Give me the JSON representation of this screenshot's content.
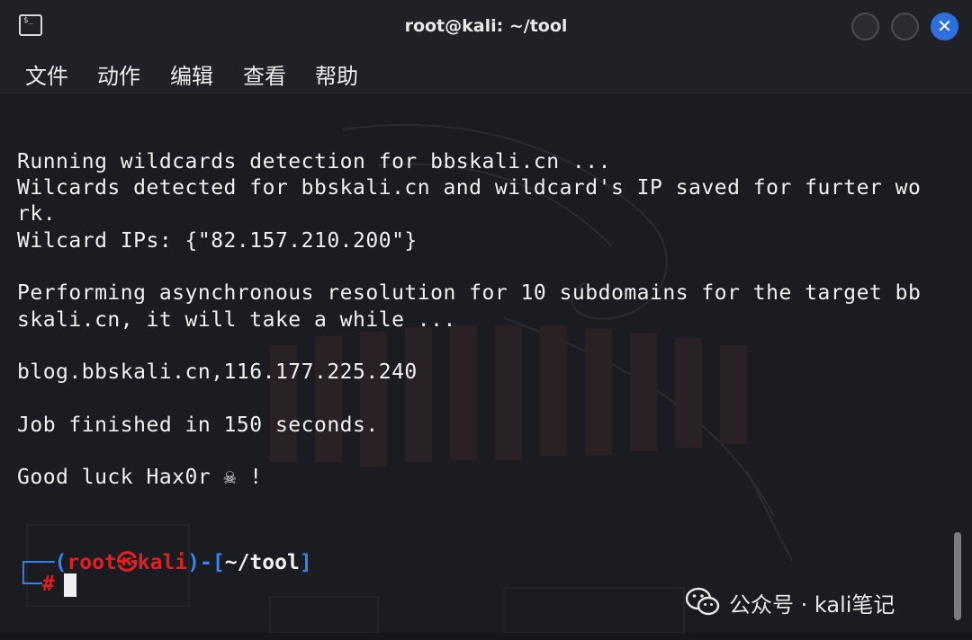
{
  "window": {
    "title": "root@kali: ~/tool",
    "icon": "terminal-icon",
    "controls": [
      "minimize",
      "maximize",
      "close"
    ],
    "close_glyph": "✕",
    "term_icon_glyph": "$_"
  },
  "menu": {
    "items": [
      "文件",
      "动作",
      "编辑",
      "查看",
      "帮助"
    ]
  },
  "terminal": {
    "lines": [
      "Running wildcards detection for bbskali.cn ...",
      "Wilcards detected for bbskali.cn and wildcard's IP saved for furter wo",
      "rk.",
      "Wilcard IPs: {\"82.157.210.200\"}",
      "",
      "Performing asynchronous resolution for 10 subdomains for the target bb",
      "skali.cn, it will take a while ...",
      "",
      "blog.bbskali.cn,116.177.225.240",
      "",
      "Job finished in 150 seconds.",
      "",
      "Good luck Hax0r ☠ !"
    ],
    "prompt": {
      "corner_top": "┌──(",
      "user": "root㉿kali",
      "mid": ")-[",
      "path": "~/tool",
      "end": "]",
      "corner_bottom": "└─",
      "symbol": "#"
    }
  },
  "watermark": {
    "brand": "公众号 · kali笔记"
  },
  "colors": {
    "prompt_blue": "#3b82f6",
    "prompt_red": "#e02020",
    "close_button": "#2f6fdc"
  }
}
